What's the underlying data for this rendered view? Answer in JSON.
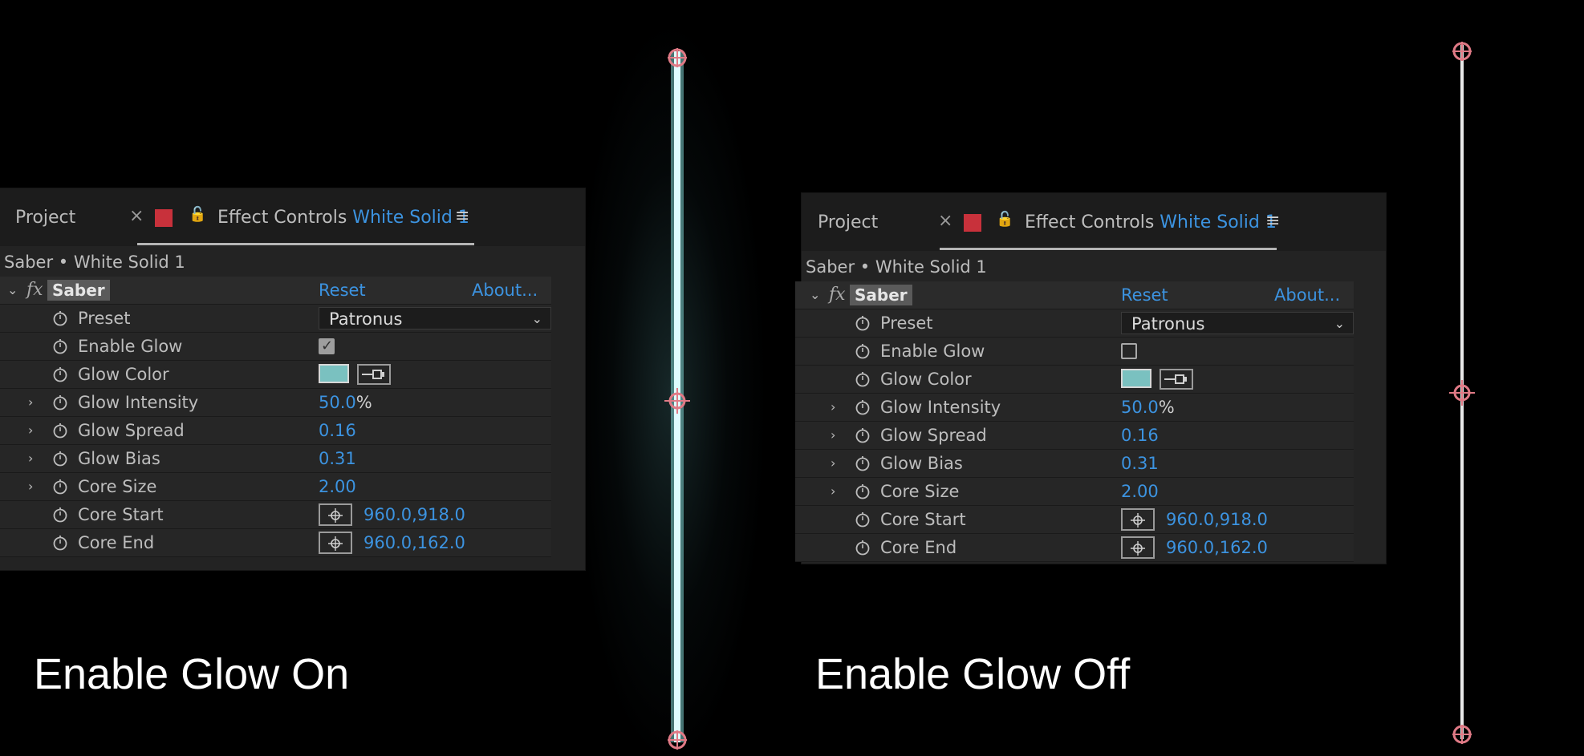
{
  "accent_color": "#3c93e0",
  "glow_color": "#7ac1c0",
  "panels": [
    {
      "tabs": {
        "project": "Project",
        "close": "×",
        "effect_controls": "Effect Controls",
        "layer_name": "White Solid 1",
        "menu": "≡"
      },
      "breadcrumb": "Saber • White Solid 1",
      "effect": {
        "name": "Saber",
        "reset": "Reset",
        "about": "About..."
      },
      "params": {
        "preset_label": "Preset",
        "preset_value": "Patronus",
        "enable_glow_label": "Enable Glow",
        "enable_glow_checked": true,
        "glow_color_label": "Glow Color",
        "glow_intensity_label": "Glow Intensity",
        "glow_intensity_value": "50.0",
        "glow_intensity_unit": "%",
        "glow_spread_label": "Glow Spread",
        "glow_spread_value": "0.16",
        "glow_bias_label": "Glow Bias",
        "glow_bias_value": "0.31",
        "core_size_label": "Core Size",
        "core_size_value": "2.00",
        "core_start_label": "Core Start",
        "core_start_value": "960.0,918.0",
        "core_end_label": "Core End",
        "core_end_value": "960.0,162.0"
      },
      "caption": "Enable Glow On"
    },
    {
      "tabs": {
        "project": "Project",
        "close": "×",
        "effect_controls": "Effect Controls",
        "layer_name": "White Solid 1",
        "menu": "≡"
      },
      "breadcrumb": "Saber • White Solid 1",
      "effect": {
        "name": "Saber",
        "reset": "Reset",
        "about": "About..."
      },
      "params": {
        "preset_label": "Preset",
        "preset_value": "Patronus",
        "enable_glow_label": "Enable Glow",
        "enable_glow_checked": false,
        "glow_color_label": "Glow Color",
        "glow_intensity_label": "Glow Intensity",
        "glow_intensity_value": "50.0",
        "glow_intensity_unit": "%",
        "glow_spread_label": "Glow Spread",
        "glow_spread_value": "0.16",
        "glow_bias_label": "Glow Bias",
        "glow_bias_value": "0.31",
        "core_size_label": "Core Size",
        "core_size_value": "2.00",
        "core_start_label": "Core Start",
        "core_start_value": "960.0,918.0",
        "core_end_label": "Core End",
        "core_end_value": "960.0,162.0"
      },
      "caption": "Enable Glow Off"
    }
  ]
}
